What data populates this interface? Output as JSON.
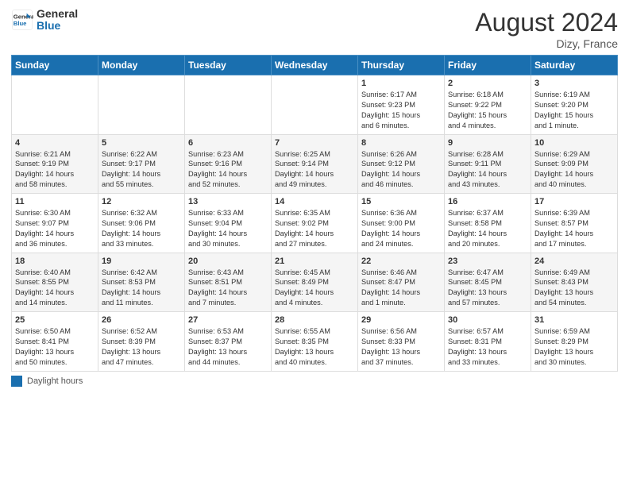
{
  "header": {
    "logo_line1": "General",
    "logo_line2": "Blue",
    "month": "August 2024",
    "location": "Dizy, France"
  },
  "days_of_week": [
    "Sunday",
    "Monday",
    "Tuesday",
    "Wednesday",
    "Thursday",
    "Friday",
    "Saturday"
  ],
  "legend": {
    "label": "Daylight hours"
  },
  "weeks": [
    [
      {
        "day": "",
        "info": ""
      },
      {
        "day": "",
        "info": ""
      },
      {
        "day": "",
        "info": ""
      },
      {
        "day": "",
        "info": ""
      },
      {
        "day": "1",
        "info": "Sunrise: 6:17 AM\nSunset: 9:23 PM\nDaylight: 15 hours\nand 6 minutes."
      },
      {
        "day": "2",
        "info": "Sunrise: 6:18 AM\nSunset: 9:22 PM\nDaylight: 15 hours\nand 4 minutes."
      },
      {
        "day": "3",
        "info": "Sunrise: 6:19 AM\nSunset: 9:20 PM\nDaylight: 15 hours\nand 1 minute."
      }
    ],
    [
      {
        "day": "4",
        "info": "Sunrise: 6:21 AM\nSunset: 9:19 PM\nDaylight: 14 hours\nand 58 minutes."
      },
      {
        "day": "5",
        "info": "Sunrise: 6:22 AM\nSunset: 9:17 PM\nDaylight: 14 hours\nand 55 minutes."
      },
      {
        "day": "6",
        "info": "Sunrise: 6:23 AM\nSunset: 9:16 PM\nDaylight: 14 hours\nand 52 minutes."
      },
      {
        "day": "7",
        "info": "Sunrise: 6:25 AM\nSunset: 9:14 PM\nDaylight: 14 hours\nand 49 minutes."
      },
      {
        "day": "8",
        "info": "Sunrise: 6:26 AM\nSunset: 9:12 PM\nDaylight: 14 hours\nand 46 minutes."
      },
      {
        "day": "9",
        "info": "Sunrise: 6:28 AM\nSunset: 9:11 PM\nDaylight: 14 hours\nand 43 minutes."
      },
      {
        "day": "10",
        "info": "Sunrise: 6:29 AM\nSunset: 9:09 PM\nDaylight: 14 hours\nand 40 minutes."
      }
    ],
    [
      {
        "day": "11",
        "info": "Sunrise: 6:30 AM\nSunset: 9:07 PM\nDaylight: 14 hours\nand 36 minutes."
      },
      {
        "day": "12",
        "info": "Sunrise: 6:32 AM\nSunset: 9:06 PM\nDaylight: 14 hours\nand 33 minutes."
      },
      {
        "day": "13",
        "info": "Sunrise: 6:33 AM\nSunset: 9:04 PM\nDaylight: 14 hours\nand 30 minutes."
      },
      {
        "day": "14",
        "info": "Sunrise: 6:35 AM\nSunset: 9:02 PM\nDaylight: 14 hours\nand 27 minutes."
      },
      {
        "day": "15",
        "info": "Sunrise: 6:36 AM\nSunset: 9:00 PM\nDaylight: 14 hours\nand 24 minutes."
      },
      {
        "day": "16",
        "info": "Sunrise: 6:37 AM\nSunset: 8:58 PM\nDaylight: 14 hours\nand 20 minutes."
      },
      {
        "day": "17",
        "info": "Sunrise: 6:39 AM\nSunset: 8:57 PM\nDaylight: 14 hours\nand 17 minutes."
      }
    ],
    [
      {
        "day": "18",
        "info": "Sunrise: 6:40 AM\nSunset: 8:55 PM\nDaylight: 14 hours\nand 14 minutes."
      },
      {
        "day": "19",
        "info": "Sunrise: 6:42 AM\nSunset: 8:53 PM\nDaylight: 14 hours\nand 11 minutes."
      },
      {
        "day": "20",
        "info": "Sunrise: 6:43 AM\nSunset: 8:51 PM\nDaylight: 14 hours\nand 7 minutes."
      },
      {
        "day": "21",
        "info": "Sunrise: 6:45 AM\nSunset: 8:49 PM\nDaylight: 14 hours\nand 4 minutes."
      },
      {
        "day": "22",
        "info": "Sunrise: 6:46 AM\nSunset: 8:47 PM\nDaylight: 14 hours\nand 1 minute."
      },
      {
        "day": "23",
        "info": "Sunrise: 6:47 AM\nSunset: 8:45 PM\nDaylight: 13 hours\nand 57 minutes."
      },
      {
        "day": "24",
        "info": "Sunrise: 6:49 AM\nSunset: 8:43 PM\nDaylight: 13 hours\nand 54 minutes."
      }
    ],
    [
      {
        "day": "25",
        "info": "Sunrise: 6:50 AM\nSunset: 8:41 PM\nDaylight: 13 hours\nand 50 minutes."
      },
      {
        "day": "26",
        "info": "Sunrise: 6:52 AM\nSunset: 8:39 PM\nDaylight: 13 hours\nand 47 minutes."
      },
      {
        "day": "27",
        "info": "Sunrise: 6:53 AM\nSunset: 8:37 PM\nDaylight: 13 hours\nand 44 minutes."
      },
      {
        "day": "28",
        "info": "Sunrise: 6:55 AM\nSunset: 8:35 PM\nDaylight: 13 hours\nand 40 minutes."
      },
      {
        "day": "29",
        "info": "Sunrise: 6:56 AM\nSunset: 8:33 PM\nDaylight: 13 hours\nand 37 minutes."
      },
      {
        "day": "30",
        "info": "Sunrise: 6:57 AM\nSunset: 8:31 PM\nDaylight: 13 hours\nand 33 minutes."
      },
      {
        "day": "31",
        "info": "Sunrise: 6:59 AM\nSunset: 8:29 PM\nDaylight: 13 hours\nand 30 minutes."
      }
    ]
  ]
}
